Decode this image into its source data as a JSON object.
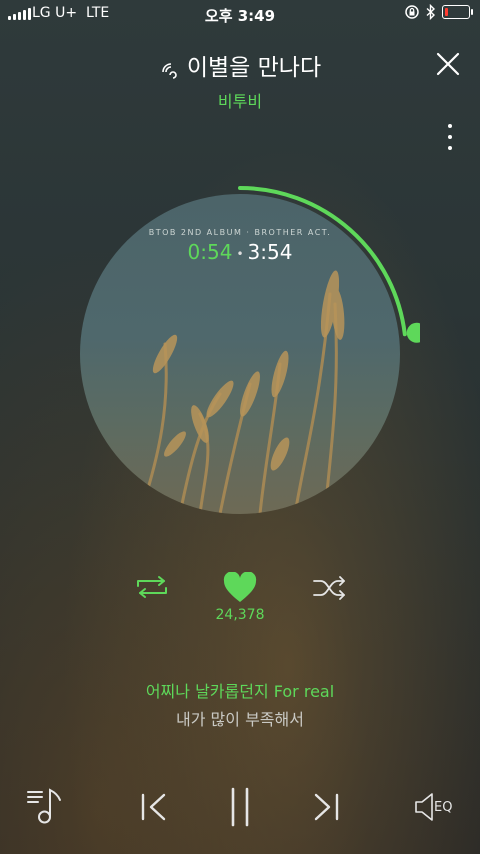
{
  "status_bar": {
    "carrier": "LG U+",
    "network": "LTE",
    "time": "오후 3:49",
    "battery_level": 0.15,
    "battery_color": "#ff3b30"
  },
  "header": {
    "title": "이별을 만나다",
    "artist": "비투비",
    "wave_icon": "sound-wave-icon",
    "close_icon": "close-icon",
    "more_icon": "more-vertical-icon"
  },
  "player": {
    "album_caption": "BTOB 2ND ALBUM · BROTHER ACT.",
    "current_time": "0:54",
    "separator": "•",
    "total_time": "3:54",
    "progress": 0.231,
    "accent_color": "#5ed85a"
  },
  "actions": {
    "repeat_icon": "repeat-icon",
    "heart_icon": "heart-icon",
    "likes": "24,378",
    "shuffle_icon": "shuffle-icon"
  },
  "lyrics": {
    "current": "어찌나 날카롭던지 For real",
    "next": "내가 많이 부족해서"
  },
  "bottom_bar": {
    "playlist_icon": "playlist-icon",
    "prev_icon": "previous-icon",
    "pause_icon": "pause-icon",
    "next_icon": "next-icon",
    "eq_label": "EQ"
  }
}
